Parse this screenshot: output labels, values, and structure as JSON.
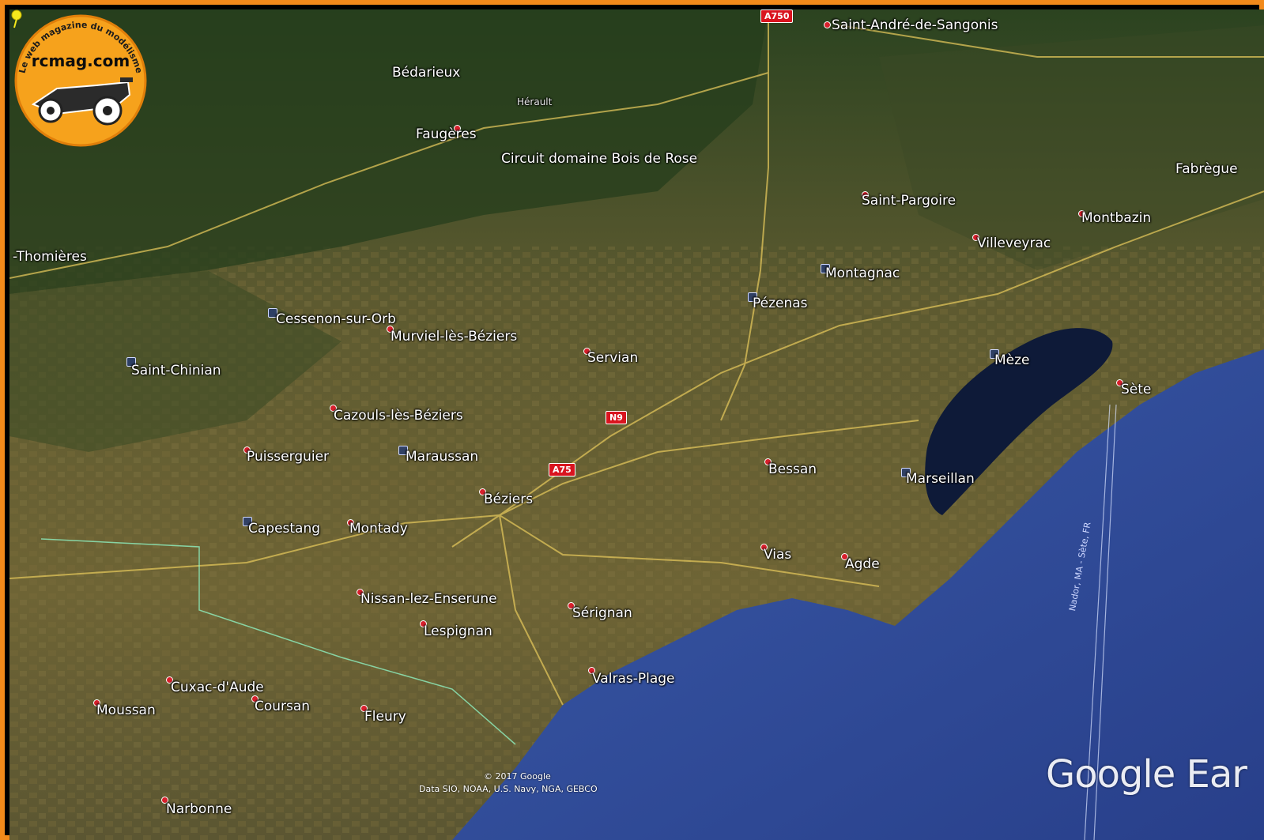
{
  "map": {
    "region_label": "Hérault",
    "marker": {
      "label": "Circuit domaine Bois de Rose"
    },
    "places": [
      {
        "id": "saint-andre",
        "label": "Saint-André-de-Sangonis"
      },
      {
        "id": "bedarieux",
        "label": "Bédarieux"
      },
      {
        "id": "faugeres",
        "label": "Faugères"
      },
      {
        "id": "saint-pargoire",
        "label": "Saint-Pargoire"
      },
      {
        "id": "montbazin",
        "label": "Montbazin"
      },
      {
        "id": "fabregue",
        "label": "Fabrègue"
      },
      {
        "id": "villeveyrac",
        "label": "Villeveyrac"
      },
      {
        "id": "thomieres",
        "label": "-Thomières"
      },
      {
        "id": "montagnac",
        "label": "Montagnac"
      },
      {
        "id": "pezenas",
        "label": "Pézenas"
      },
      {
        "id": "cessenon",
        "label": "Cessenon-sur-Orb"
      },
      {
        "id": "murviel",
        "label": "Murviel-lès-Béziers"
      },
      {
        "id": "servian",
        "label": "Servian"
      },
      {
        "id": "meze",
        "label": "Mèze"
      },
      {
        "id": "sete",
        "label": "Sète"
      },
      {
        "id": "saint-chinian",
        "label": "Saint-Chinian"
      },
      {
        "id": "cazouls",
        "label": "Cazouls-lès-Béziers"
      },
      {
        "id": "puisserguier",
        "label": "Puisserguier"
      },
      {
        "id": "maraussan",
        "label": "Maraussan"
      },
      {
        "id": "bessan",
        "label": "Bessan"
      },
      {
        "id": "marseillan",
        "label": "Marseillan"
      },
      {
        "id": "beziers",
        "label": "Béziers"
      },
      {
        "id": "capestang",
        "label": "Capestang"
      },
      {
        "id": "montady",
        "label": "Montady"
      },
      {
        "id": "vias",
        "label": "Vias"
      },
      {
        "id": "agde",
        "label": "Agde"
      },
      {
        "id": "nissan",
        "label": "Nissan-lez-Enserune"
      },
      {
        "id": "serignan",
        "label": "Sérignan"
      },
      {
        "id": "lespignan",
        "label": "Lespignan"
      },
      {
        "id": "valras",
        "label": "Valras-Plage"
      },
      {
        "id": "cuxac",
        "label": "Cuxac-d'Aude"
      },
      {
        "id": "moussan",
        "label": "Moussan"
      },
      {
        "id": "coursan",
        "label": "Coursan"
      },
      {
        "id": "fleury",
        "label": "Fleury"
      },
      {
        "id": "narbonne",
        "label": "Narbonne"
      }
    ],
    "roads": [
      {
        "id": "a750",
        "label": "A750"
      },
      {
        "id": "n9",
        "label": "N9"
      },
      {
        "id": "a75",
        "label": "A75"
      }
    ],
    "shipping_lane_label": "Nador, MA - Sète, FR",
    "colors": {
      "sea": "#2f4f9a",
      "lagoon": "#0f1b3a",
      "land": "#6b6236",
      "forest": "#2c4420",
      "frame": "#f28a1a",
      "road": "#e0c45a"
    }
  },
  "credits": {
    "copyright": "© 2017 Google",
    "data": "Data SIO, NOAA, U.S. Navy, NGA, GEBCO",
    "logo": "Google Ear"
  },
  "badge": {
    "site": "rcmag.com",
    "tagline": "Le web magazine du modélisme"
  }
}
